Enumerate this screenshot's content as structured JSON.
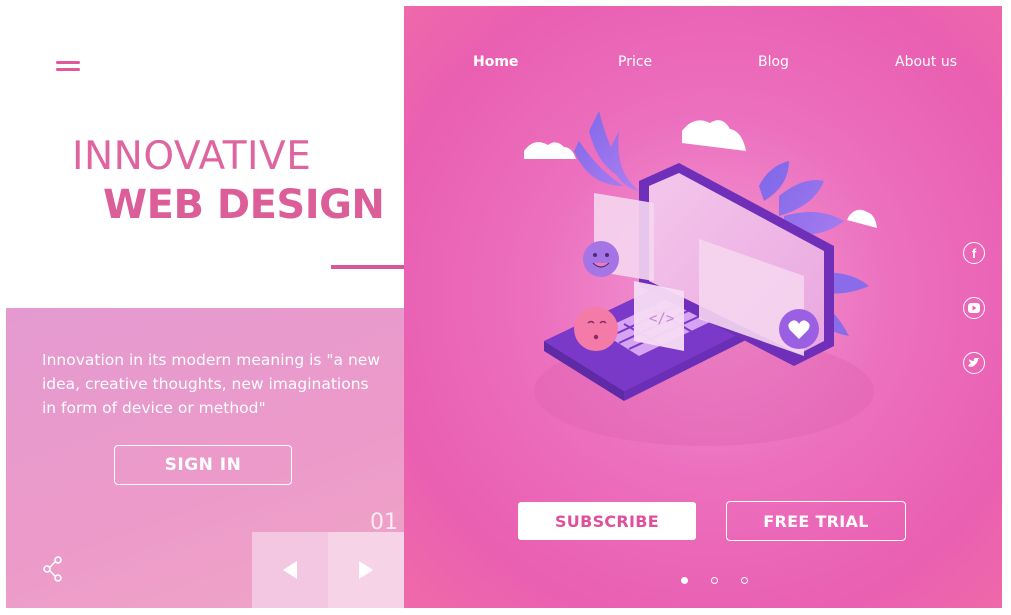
{
  "brand": {
    "accent": "#e0509a",
    "panel_gradient_start": "#e49ad1",
    "hero_pink": "#ea5fb1"
  },
  "hero": {
    "title_line1": "INNOVATIVE",
    "title_line2": "WEB DESIGN",
    "description": "Innovation in its modern meaning is \"a new idea, creative thoughts, new imaginations in form of device or method\""
  },
  "actions": {
    "sign_in_label": "SIGN IN",
    "subscribe_label": "SUBSCRIBE",
    "free_trial_label": "FREE  TRIAL"
  },
  "nav": {
    "items": [
      {
        "label": "Home",
        "active": true
      },
      {
        "label": "Price",
        "active": false
      },
      {
        "label": "Blog",
        "active": false
      },
      {
        "label": "About us",
        "active": false
      }
    ]
  },
  "pager": {
    "current": "01",
    "prev_icon": "triangle-left-icon",
    "next_icon": "triangle-right-icon"
  },
  "social": [
    "facebook-icon",
    "youtube-icon",
    "twitter-icon"
  ],
  "slider_dots": {
    "count": 3,
    "active_index": 0
  }
}
